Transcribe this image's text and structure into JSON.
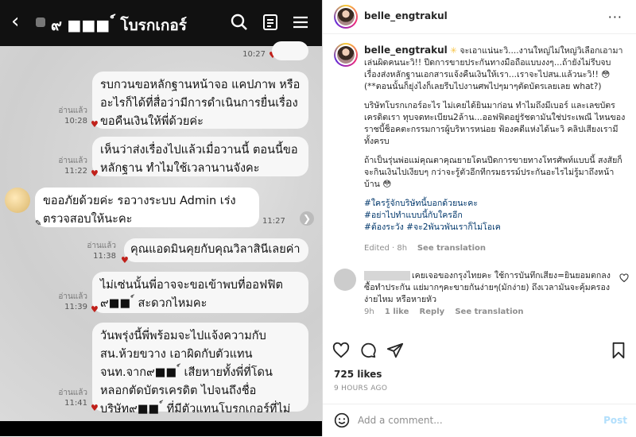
{
  "chat": {
    "title": "๙ ■■■ ์ โบรกเกอร์",
    "top_time": "10:27",
    "messages": [
      {
        "text": "รบกวนขอหลักฐานหน้าจอ แคปภาพ หรืออะไรก็ได้ที่สื่อว่ามีการดำเนินการยื่นเรื่องขอคืนเงินให้พี่ด้วยค่ะ",
        "read": "อ่านแล้ว",
        "time": "10:28"
      },
      {
        "text": "เห็นว่าส่งเรื่องไปแล้วเมื่อวานนี้ ตอนนี้ขอหลักฐาน ทำไมใช้เวลานานจังคะ",
        "read": "อ่านแล้ว",
        "time": "11:22"
      },
      {
        "text": "ขออภัยด้วยค่ะ รอวางระบบ  Admin  เร่งตรวจสอบให้นะคะ",
        "read": "",
        "time": "11:27"
      },
      {
        "text": "คุณแอดมินคุยกับคุณวิลาสินีเลยค่า",
        "read": "อ่านแล้ว",
        "time": "11:38"
      },
      {
        "text": "ไม่เซ่นนั้นพี่อาจจะขอเข้าพบที่ออฟฟิต ๙■■ ์ สะดวกไหมคะ",
        "read": "อ่านแล้ว",
        "time": "11:39"
      },
      {
        "text": "วันพรุ่งนี้พี่พร้อมจะไปแจ้งความกับ สน.ห้วยขวาง เอาผิดกับตัวแทน จนท.จาก๙■■ ์ เสียหายทั้งพี่ที่โดนหลอกตัดบัตรเครดิต ไปจนถึงชื่อบริษัท๙■■ ์ ที่มีตัวแทนโบรกเกอร์ที่ไม่เหมาะสมค่ะ",
        "read": "อ่านแล้ว",
        "time": "11:41"
      }
    ]
  },
  "post": {
    "username": "belle_engtrakul",
    "caption_paragraphs": [
      "จะเอาแน่นะวิ....งานใหญ่ไม่ใหญ่วิเลือกเอามาเล่นผิดคนนะวิ!! ปีดการขายประกันทางมือถือแบบงงๆ...ถ้ายังไม่รีบจบเรื่องส่งหลักฐานเอกสารแจ้งคืนเงินให้เรา...เราจะไปสน.แล้วนะวิ!! 😳 (**ตอนนั้นก็ยุ่งไงก็เลยรีบไปงานศพไปๆมาๆตัดบัตรเลยเลย what?)",
      "บริษัทโบรกเกอร์อะไร ไม่เคยได้ยินมาก่อน ทำไมถึงมีเบอร์ และเลขบัตรเครดิตเรา ทุบจดทะเบียน2ล้าน...ออฟฟิตอยู่รัชดามันใช่ประเพณี ไหนของราชบี้ช็อคตะกรรมการผู้บริหารหน่อย ฟ้องคดีแห่งได้นะวิ คลิปเสียงเรามีทั้งครบ",
      "ถ้าเป็นรุ่นพ่อแม่คุณตาคุณยายโดนปีดการขายทางโทรศัพท์แบบนี้ สงสัยก็จะกินเงินไปเงียบๆ กว่าจะรู้ตัวอีกทีกรมธรรม์ประกันอะไรไม่รู้มาถึงหน้าบ้าน 😳"
    ],
    "hashtags": [
      "#ใครรู้จักบริษัทนี้บอกด้วยนะคะ",
      "#อย่าไปทำแบบนี้กับใครอีก",
      "#ต้องระวัง #จะ2พันวพันเราก็ไม่โอเค"
    ],
    "caption_meta": {
      "status": "Edited · 8h",
      "see_translation": "See translation"
    },
    "comment": {
      "text": "เคยเจอของกรุงไทยคะ ใช้การบันทึกเสียง=ยินยอมตกลง ซื้อทำประกัน แย่มากๆคะขายกันง่ายๆ(มักง่าย) ถึงเวลามันจะคุ้มครองง่ายไหม หรือหายหัว",
      "time": "9h",
      "likes": "1 like",
      "reply": "Reply",
      "see_translation": "See translation"
    },
    "likes": "725 likes",
    "ago": "9 HOURS AGO",
    "add_comment_placeholder": "Add a comment...",
    "post_button": "Post",
    "more": "···"
  }
}
